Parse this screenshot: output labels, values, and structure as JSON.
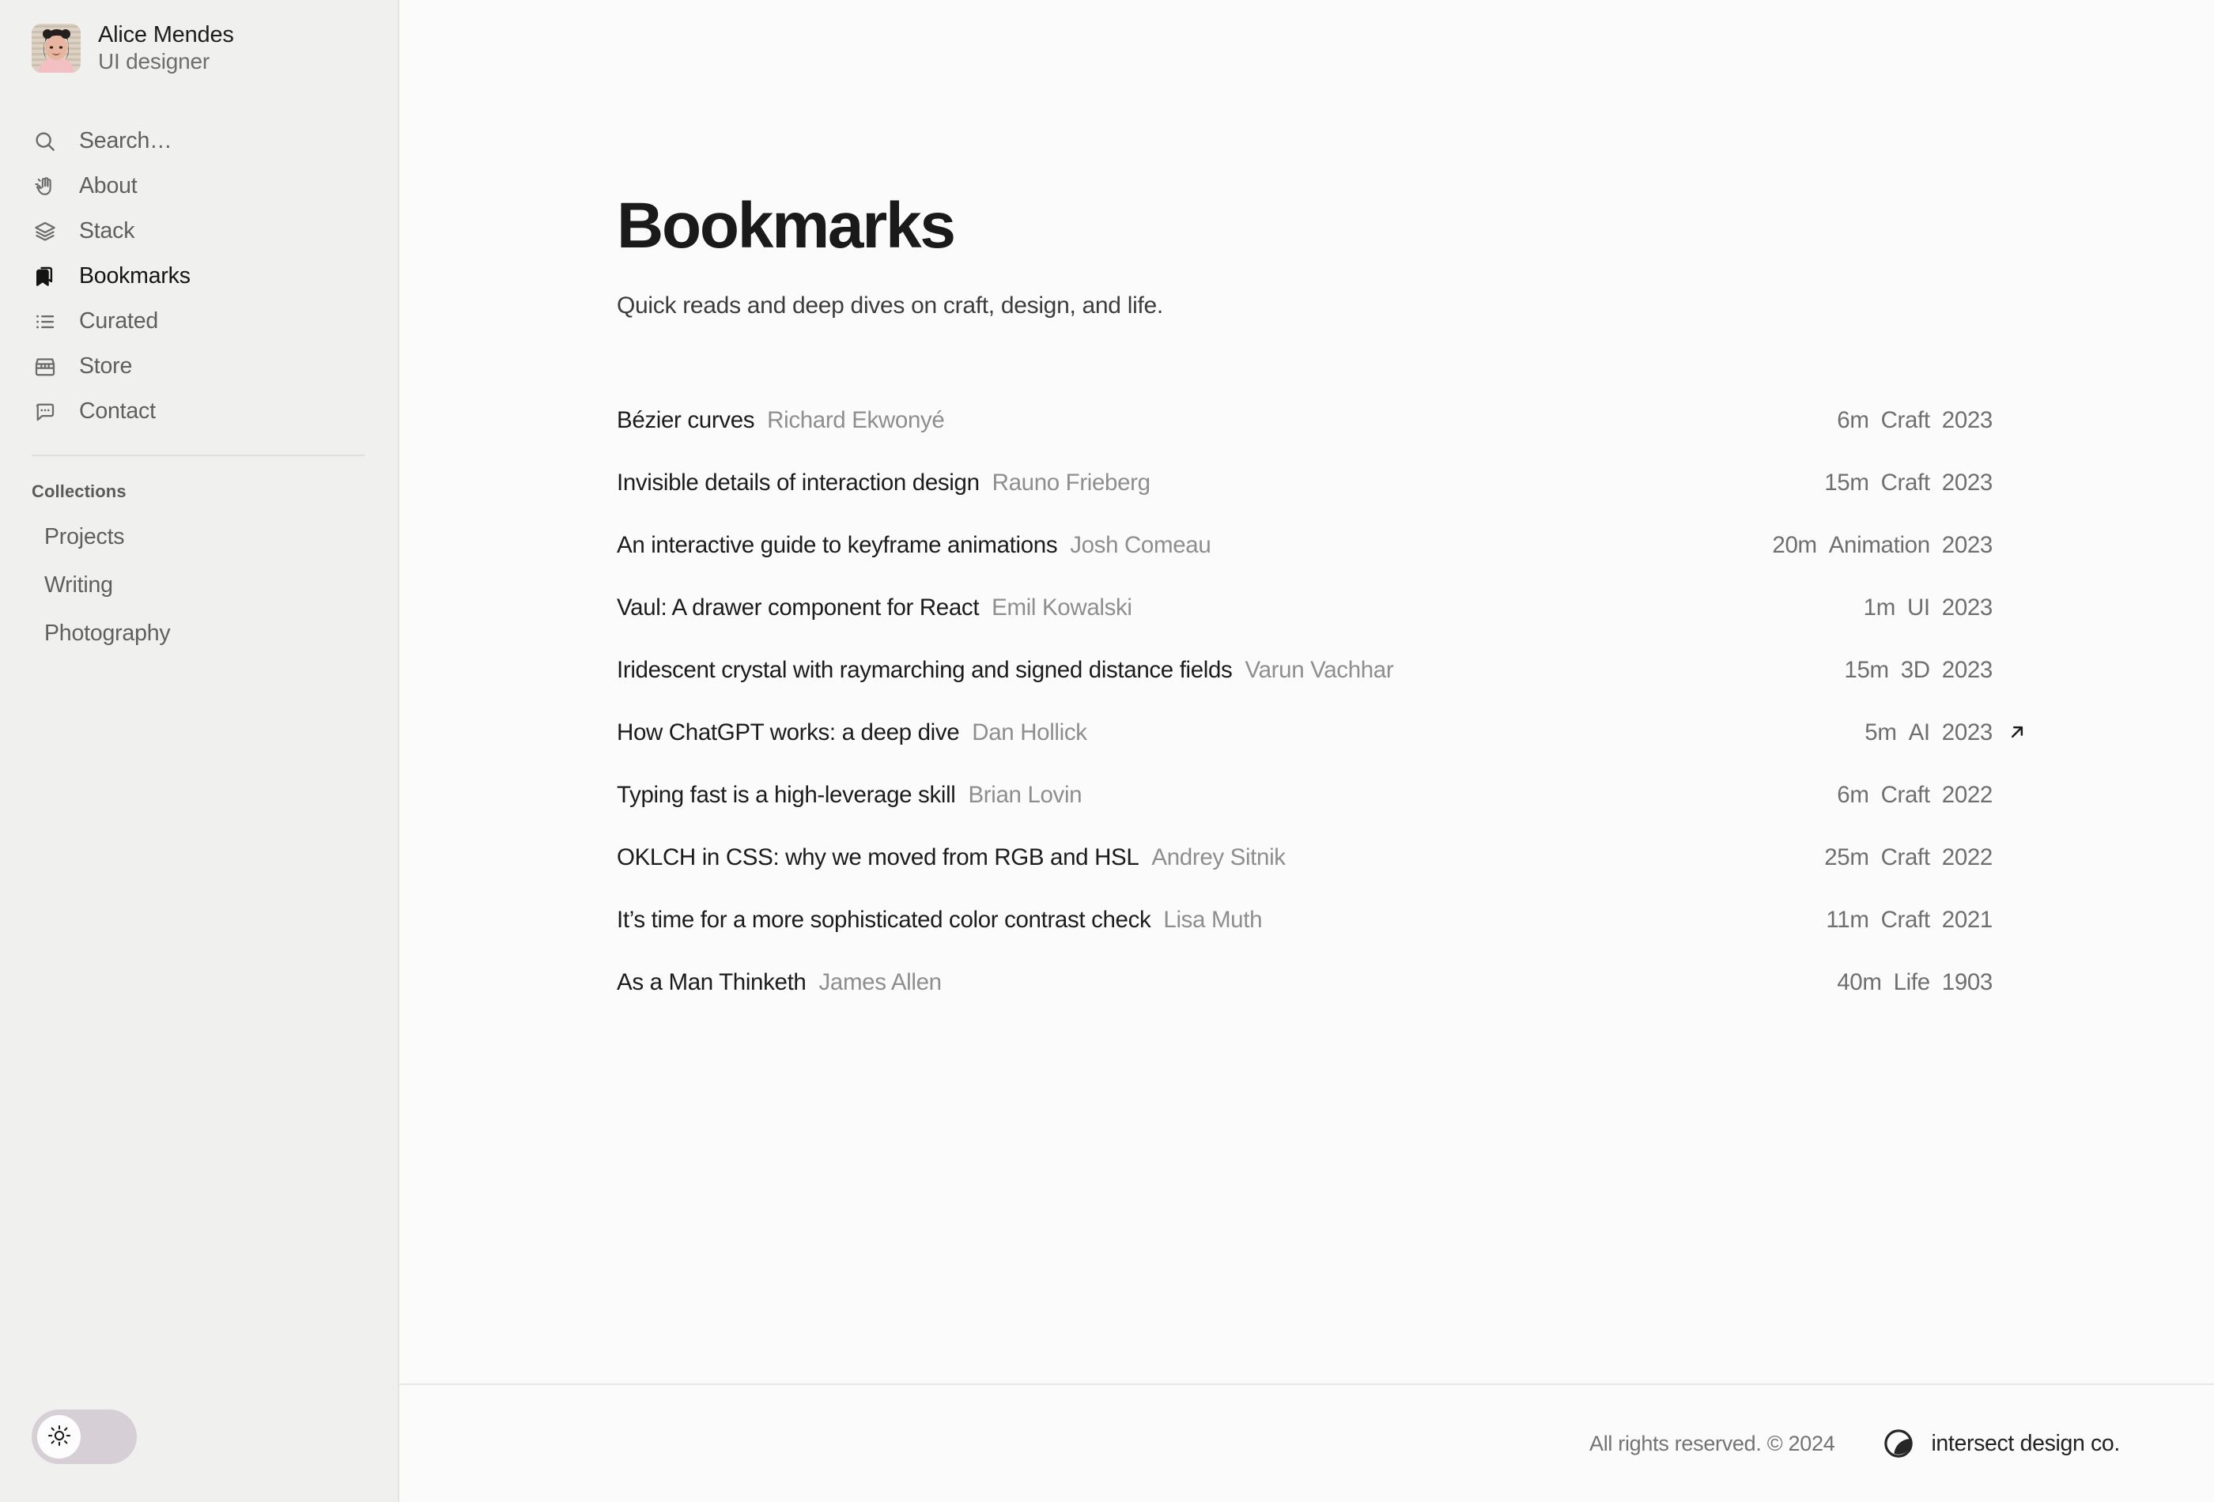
{
  "sidebar": {
    "profile": {
      "name": "Alice Mendes",
      "role": "UI designer",
      "avatar_icon": "avatar-photo"
    },
    "nav": [
      {
        "label": "Search…",
        "icon": "search-icon",
        "key": "search",
        "active": false
      },
      {
        "label": "About",
        "icon": "waving-hand-icon",
        "key": "about",
        "active": false
      },
      {
        "label": "Stack",
        "icon": "layers-icon",
        "key": "stack",
        "active": false
      },
      {
        "label": "Bookmarks",
        "icon": "bookmark-icon",
        "key": "bookmarks",
        "active": true
      },
      {
        "label": "Curated",
        "icon": "list-icon",
        "key": "curated",
        "active": false
      },
      {
        "label": "Store",
        "icon": "storefront-icon",
        "key": "store",
        "active": false
      },
      {
        "label": "Contact",
        "icon": "chat-bubble-icon",
        "key": "contact",
        "active": false
      }
    ],
    "collections_heading": "Collections",
    "collections": [
      {
        "label": "Projects"
      },
      {
        "label": "Writing"
      },
      {
        "label": "Photography"
      }
    ],
    "theme_toggle": {
      "icon": "sun-icon",
      "state": "light",
      "track_color": "#d6cfd6",
      "knob_color": "#fdfdfd"
    }
  },
  "main": {
    "title": "Bookmarks",
    "subtitle": "Quick reads and deep dives on craft, design, and life.",
    "bookmarks": [
      {
        "title": "Bézier curves",
        "author": "Richard Ekwonyé",
        "read_time": "6m",
        "category": "Craft",
        "year": "2023",
        "external": false
      },
      {
        "title": "Invisible details of interaction design",
        "author": "Rauno Frieberg",
        "read_time": "15m",
        "category": "Craft",
        "year": "2023",
        "external": false
      },
      {
        "title": "An interactive guide to keyframe animations",
        "author": "Josh Comeau",
        "read_time": "20m",
        "category": "Animation",
        "year": "2023",
        "external": false
      },
      {
        "title": "Vaul: A drawer component for React",
        "author": "Emil Kowalski",
        "read_time": "1m",
        "category": "UI",
        "year": "2023",
        "external": false
      },
      {
        "title": "Iridescent crystal with raymarching and signed distance fields",
        "author": "Varun Vachhar",
        "read_time": "15m",
        "category": "3D",
        "year": "2023",
        "external": false
      },
      {
        "title": "How ChatGPT works: a deep dive",
        "author": "Dan Hollick",
        "read_time": "5m",
        "category": "AI",
        "year": "2023",
        "external": true
      },
      {
        "title": "Typing fast is a high-leverage skill",
        "author": "Brian Lovin",
        "read_time": "6m",
        "category": "Craft",
        "year": "2022",
        "external": false
      },
      {
        "title": "OKLCH in CSS: why we moved from RGB and HSL",
        "author": "Andrey Sitnik",
        "read_time": "25m",
        "category": "Craft",
        "year": "2022",
        "external": false
      },
      {
        "title": "It’s time for a more sophisticated color contrast check",
        "author": "Lisa Muth",
        "read_time": "11m",
        "category": "Craft",
        "year": "2021",
        "external": false
      },
      {
        "title": "As a Man Thinketh",
        "author": "James Allen",
        "read_time": "40m",
        "category": "Life",
        "year": "1903",
        "external": false
      }
    ],
    "external_link_icon": "arrow-up-right-icon"
  },
  "footer": {
    "copyright": "All rights reserved. © 2024",
    "brand_name": "intersect design co.",
    "brand_icon": "intersect-circle-logo"
  },
  "colors": {
    "sidebar_bg": "#f0f0ef",
    "main_bg": "#fbfbfb",
    "text_primary": "#1c1c1c",
    "text_muted": "#8e8e8e",
    "text_meta": "#6f6f6f",
    "divider": "#e6e6e6",
    "toggle_track": "#d6cfd6"
  }
}
